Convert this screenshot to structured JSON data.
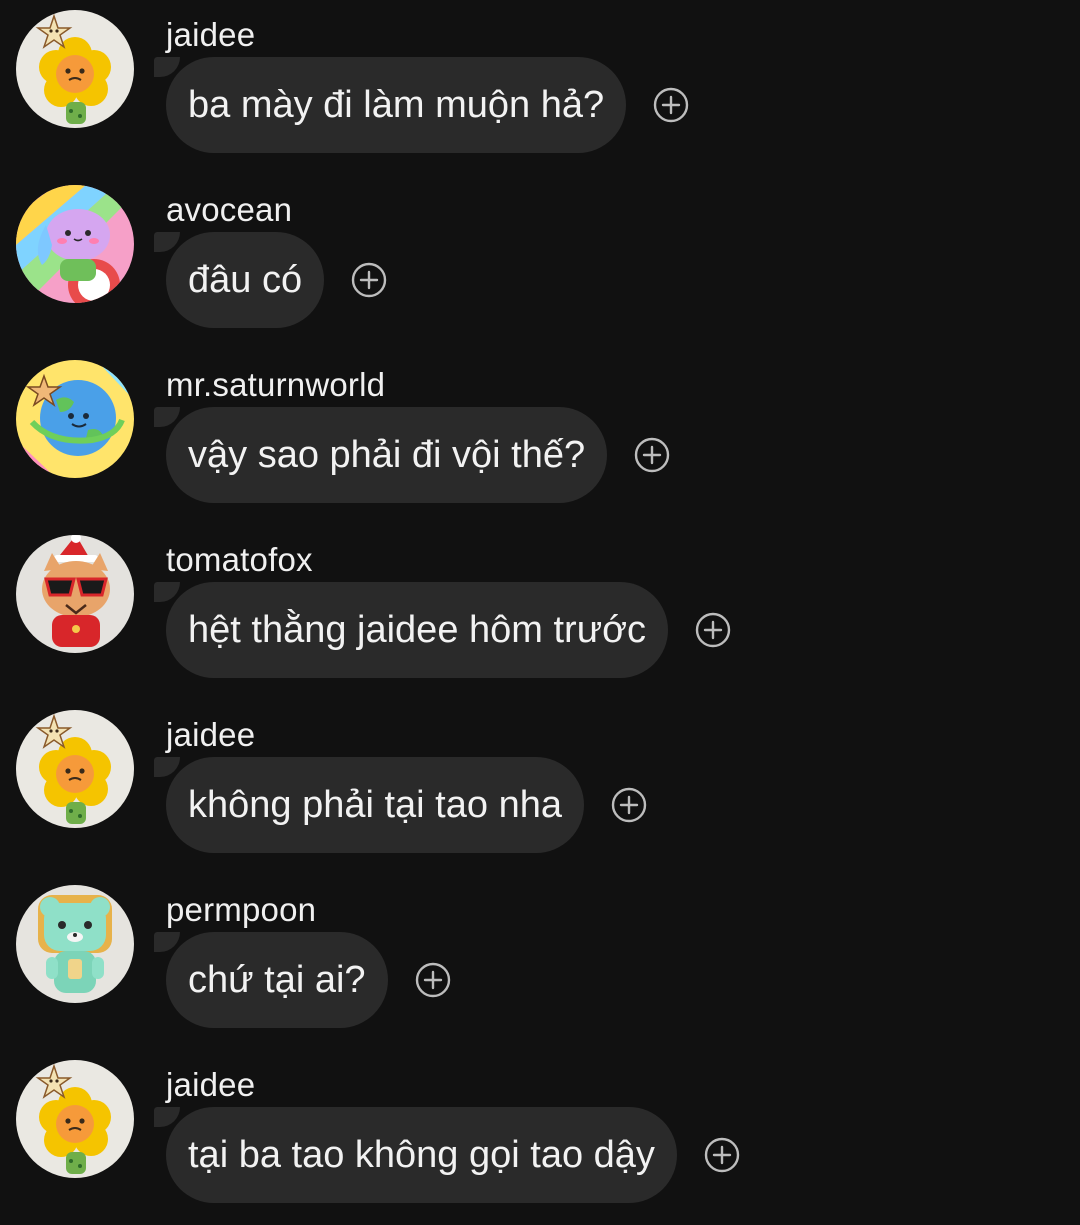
{
  "messages": [
    {
      "username": "jaidee",
      "text": "ba mày đi làm muộn hả?",
      "avatar_icon": "sunflower-avatar-icon"
    },
    {
      "username": "avocean",
      "text": "đâu có",
      "avatar_icon": "pink-creature-avatar-icon"
    },
    {
      "username": "mr.saturnworld",
      "text": "vậy sao phải đi vội thế?",
      "avatar_icon": "globe-avatar-icon"
    },
    {
      "username": "tomatofox",
      "text": "hệt thằng jaidee hôm trước",
      "avatar_icon": "fox-sunglasses-avatar-icon"
    },
    {
      "username": "jaidee",
      "text": "không phải tại tao nha",
      "avatar_icon": "sunflower-avatar-icon"
    },
    {
      "username": "permpoon",
      "text": "chứ tại ai?",
      "avatar_icon": "mint-bear-avatar-icon"
    },
    {
      "username": "jaidee",
      "text": "tại ba tao không gọi tao dậy",
      "avatar_icon": "sunflower-avatar-icon"
    }
  ],
  "reaction_icon": "add-reaction-icon",
  "colors": {
    "background": "#111111",
    "bubble": "#2a2a2a",
    "text": "#f2f2f2",
    "icon": "#bdbdbd"
  }
}
